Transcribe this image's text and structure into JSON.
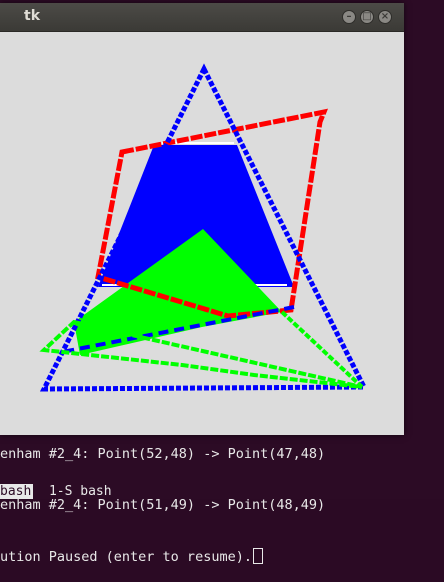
{
  "window": {
    "title": "tk",
    "buttons": {
      "minimize": "–",
      "maximize": "□",
      "close": "×"
    }
  },
  "terminal": {
    "lines": [
      "enham #2_4: Point(52,48) -> Point(47,48)",
      "enham #2_4: Point(51,49) -> Point(48,49)",
      "ution Paused (enter to resume)."
    ],
    "status_bar": {
      "active": "bash",
      "other": "  1-S bash"
    }
  },
  "colors": {
    "blue": "#0000ff",
    "red": "#ff0000",
    "green": "#00ff00",
    "canvas": "#dcdcdc"
  }
}
